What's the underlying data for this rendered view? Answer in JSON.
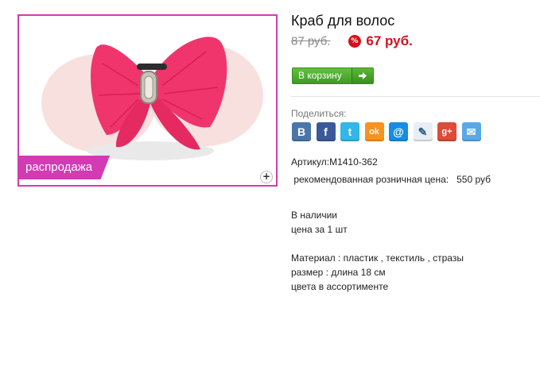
{
  "product": {
    "title": "Краб для волос",
    "old_price": "87 руб.",
    "discount_symbol": "%",
    "new_price": "67 руб.",
    "sale_badge": "распродажа",
    "zoom_symbol": "+"
  },
  "cart": {
    "label": "В корзину",
    "icon": "arrow-right-icon"
  },
  "share": {
    "label": "Поделиться:",
    "icons": [
      {
        "name": "vkontakte-icon",
        "glyph": "B",
        "color": "#4a76a8"
      },
      {
        "name": "facebook-icon",
        "glyph": "f",
        "color": "#3b5998"
      },
      {
        "name": "twitter-icon",
        "glyph": "t",
        "color": "#33b6e8"
      },
      {
        "name": "odnoklassniki-icon",
        "glyph": "ok",
        "color": "#f7931e"
      },
      {
        "name": "mailru-icon",
        "glyph": "@",
        "color": "#168de2"
      },
      {
        "name": "livejournal-icon",
        "glyph": "✎",
        "color": "#e8eef4"
      },
      {
        "name": "googleplus-icon",
        "glyph": "g+",
        "color": "#dd4b39"
      },
      {
        "name": "email-icon",
        "glyph": "✉",
        "color": "#5aa9e6"
      }
    ]
  },
  "details": {
    "article": "Артикул:М1410-362",
    "rrp": " рекомендованная розничная цена:   550 руб",
    "availability": "В наличии",
    "price_unit": "цена за 1 шт",
    "material": "Материал : пластик , текстиль , стразы",
    "size": "размер : длина 18 см",
    "colors": "цвета в ассортименте"
  },
  "colors": {
    "accent": "#d23bb4",
    "price": "#d4101d",
    "button": "#4fae2e"
  }
}
